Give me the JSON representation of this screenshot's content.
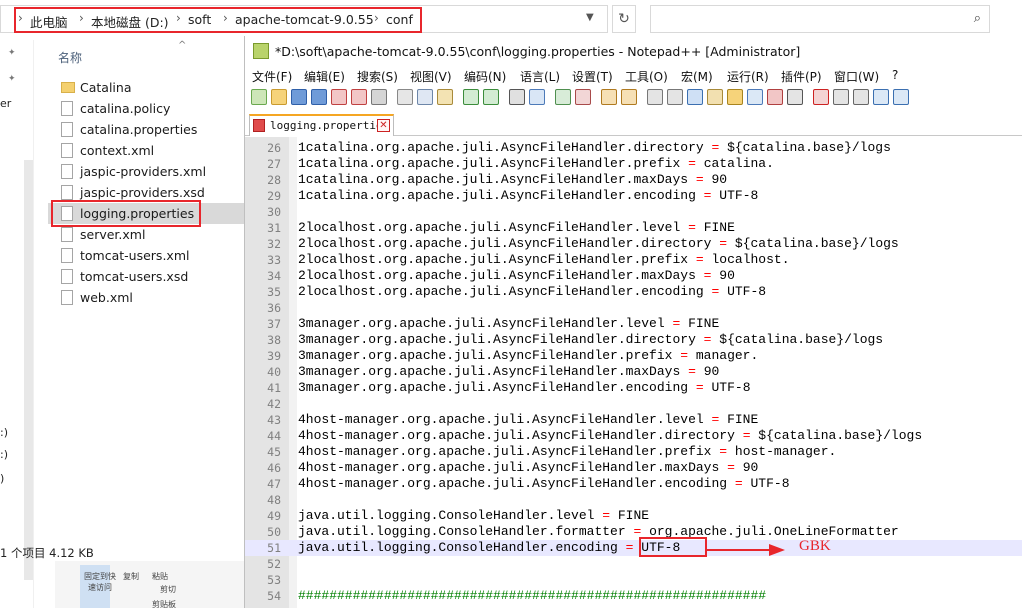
{
  "explorer": {
    "breadcrumbs": [
      "此电脑",
      "本地磁盘 (D:)",
      "soft",
      "apache-tomcat-9.0.55",
      "conf"
    ],
    "column_header": "名称",
    "files": [
      {
        "name": "Catalina",
        "type": "folder"
      },
      {
        "name": "catalina.policy",
        "type": "file"
      },
      {
        "name": "catalina.properties",
        "type": "file"
      },
      {
        "name": "context.xml",
        "type": "file"
      },
      {
        "name": "jaspic-providers.xml",
        "type": "file"
      },
      {
        "name": "jaspic-providers.xsd",
        "type": "file"
      },
      {
        "name": "logging.properties",
        "type": "file",
        "selected": true
      },
      {
        "name": "server.xml",
        "type": "file"
      },
      {
        "name": "tomcat-users.xml",
        "type": "file"
      },
      {
        "name": "tomcat-users.xsd",
        "type": "file"
      },
      {
        "name": "web.xml",
        "type": "file"
      }
    ],
    "status_text": "1 个项目  4.12 KB",
    "nav_fragments": [
      "er",
      ":)",
      ":)",
      ")"
    ],
    "ribbon_peek": [
      "固定到快",
      "速访问",
      "复制",
      "粘贴",
      "剪切",
      "剪贴板"
    ]
  },
  "notepad": {
    "title": "*D:\\soft\\apache-tomcat-9.0.55\\conf\\logging.properties - Notepad++ [Administrator]",
    "menu": [
      "文件(F)",
      "编辑(E)",
      "搜索(S)",
      "视图(V)",
      "编码(N)",
      "语言(L)",
      "设置(T)",
      "工具(O)",
      "宏(M)",
      "运行(R)",
      "插件(P)",
      "窗口(W)",
      "?"
    ],
    "tab_label": "logging.properties",
    "tab_close": "✕",
    "lines": [
      {
        "n": "26",
        "key": "1catalina.org.apache.juli.AsyncFileHandler.directory",
        "val": "${catalina.base}/logs"
      },
      {
        "n": "27",
        "key": "1catalina.org.apache.juli.AsyncFileHandler.prefix",
        "val": "catalina."
      },
      {
        "n": "28",
        "key": "1catalina.org.apache.juli.AsyncFileHandler.maxDays",
        "val": "90"
      },
      {
        "n": "29",
        "key": "1catalina.org.apache.juli.AsyncFileHandler.encoding",
        "val": "UTF-8"
      },
      {
        "n": "30",
        "key": "",
        "val": ""
      },
      {
        "n": "31",
        "key": "2localhost.org.apache.juli.AsyncFileHandler.level",
        "val": "FINE"
      },
      {
        "n": "32",
        "key": "2localhost.org.apache.juli.AsyncFileHandler.directory",
        "val": "${catalina.base}/logs"
      },
      {
        "n": "33",
        "key": "2localhost.org.apache.juli.AsyncFileHandler.prefix",
        "val": "localhost."
      },
      {
        "n": "34",
        "key": "2localhost.org.apache.juli.AsyncFileHandler.maxDays",
        "val": "90"
      },
      {
        "n": "35",
        "key": "2localhost.org.apache.juli.AsyncFileHandler.encoding",
        "val": "UTF-8"
      },
      {
        "n": "36",
        "key": "",
        "val": ""
      },
      {
        "n": "37",
        "key": "3manager.org.apache.juli.AsyncFileHandler.level",
        "val": "FINE"
      },
      {
        "n": "38",
        "key": "3manager.org.apache.juli.AsyncFileHandler.directory",
        "val": "${catalina.base}/logs"
      },
      {
        "n": "39",
        "key": "3manager.org.apache.juli.AsyncFileHandler.prefix",
        "val": "manager."
      },
      {
        "n": "40",
        "key": "3manager.org.apache.juli.AsyncFileHandler.maxDays",
        "val": "90"
      },
      {
        "n": "41",
        "key": "3manager.org.apache.juli.AsyncFileHandler.encoding",
        "val": "UTF-8"
      },
      {
        "n": "42",
        "key": "",
        "val": ""
      },
      {
        "n": "43",
        "key": "4host-manager.org.apache.juli.AsyncFileHandler.level",
        "val": "FINE"
      },
      {
        "n": "44",
        "key": "4host-manager.org.apache.juli.AsyncFileHandler.directory",
        "val": "${catalina.base}/logs"
      },
      {
        "n": "45",
        "key": "4host-manager.org.apache.juli.AsyncFileHandler.prefix",
        "val": "host-manager."
      },
      {
        "n": "46",
        "key": "4host-manager.org.apache.juli.AsyncFileHandler.maxDays",
        "val": "90"
      },
      {
        "n": "47",
        "key": "4host-manager.org.apache.juli.AsyncFileHandler.encoding",
        "val": "UTF-8"
      },
      {
        "n": "48",
        "key": "",
        "val": ""
      },
      {
        "n": "49",
        "key": "java.util.logging.ConsoleHandler.level",
        "val": "FINE"
      },
      {
        "n": "50",
        "key": "java.util.logging.ConsoleHandler.formatter",
        "val": "org.apache.juli.OneLineFormatter"
      },
      {
        "n": "51",
        "key": "java.util.logging.ConsoleHandler.encoding",
        "val": "UTF-8",
        "current": true
      },
      {
        "n": "52",
        "key": "",
        "val": ""
      },
      {
        "n": "53",
        "key": "",
        "val": ""
      },
      {
        "n": "54",
        "comment": "############################################################"
      }
    ],
    "annotation": "GBK"
  },
  "colors": {
    "highlight_red": "#e8262c",
    "operator_red": "#ff0000",
    "comment_green": "#008000",
    "current_line": "#e8e8ff"
  }
}
